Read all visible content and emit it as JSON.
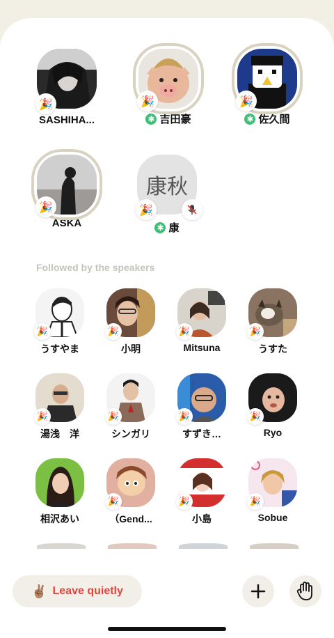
{
  "speakers": [
    {
      "name": "SASHIHA...",
      "moderator": false,
      "badge": "party-popper-icon"
    },
    {
      "name": "吉田豪",
      "moderator": true,
      "badge": "party-popper-icon"
    },
    {
      "name": "佐久間",
      "moderator": true,
      "badge": "party-popper-icon"
    },
    {
      "name": "ASKA",
      "moderator": false,
      "badge": "party-popper-icon"
    },
    {
      "name": "康",
      "moderator": true,
      "badge": "party-popper-icon",
      "initials": "康秋",
      "muted": true
    }
  ],
  "section": {
    "followed_label": "Followed by the speakers"
  },
  "listeners": [
    {
      "name": "うすやま"
    },
    {
      "name": "小明"
    },
    {
      "name": "Mitsuna"
    },
    {
      "name": "うすた"
    },
    {
      "name": "湯浅　洋"
    },
    {
      "name": "シンガリ"
    },
    {
      "name": "すずき…"
    },
    {
      "name": "Ryo"
    },
    {
      "name": "相沢あい"
    },
    {
      "name": "（Gend..."
    },
    {
      "name": "小島"
    },
    {
      "name": "Sobue"
    }
  ],
  "bottom_bar": {
    "leave_label": "Leave quietly",
    "leave_emoji": "✌🏽",
    "add_icon": "plus-icon",
    "raise_hand_icon": "raise-hand-icon"
  },
  "colors": {
    "accent_red": "#e0453c",
    "moderator_green": "#3fbf76",
    "ring": "#d8d2c0",
    "background": "#f2efe4"
  }
}
